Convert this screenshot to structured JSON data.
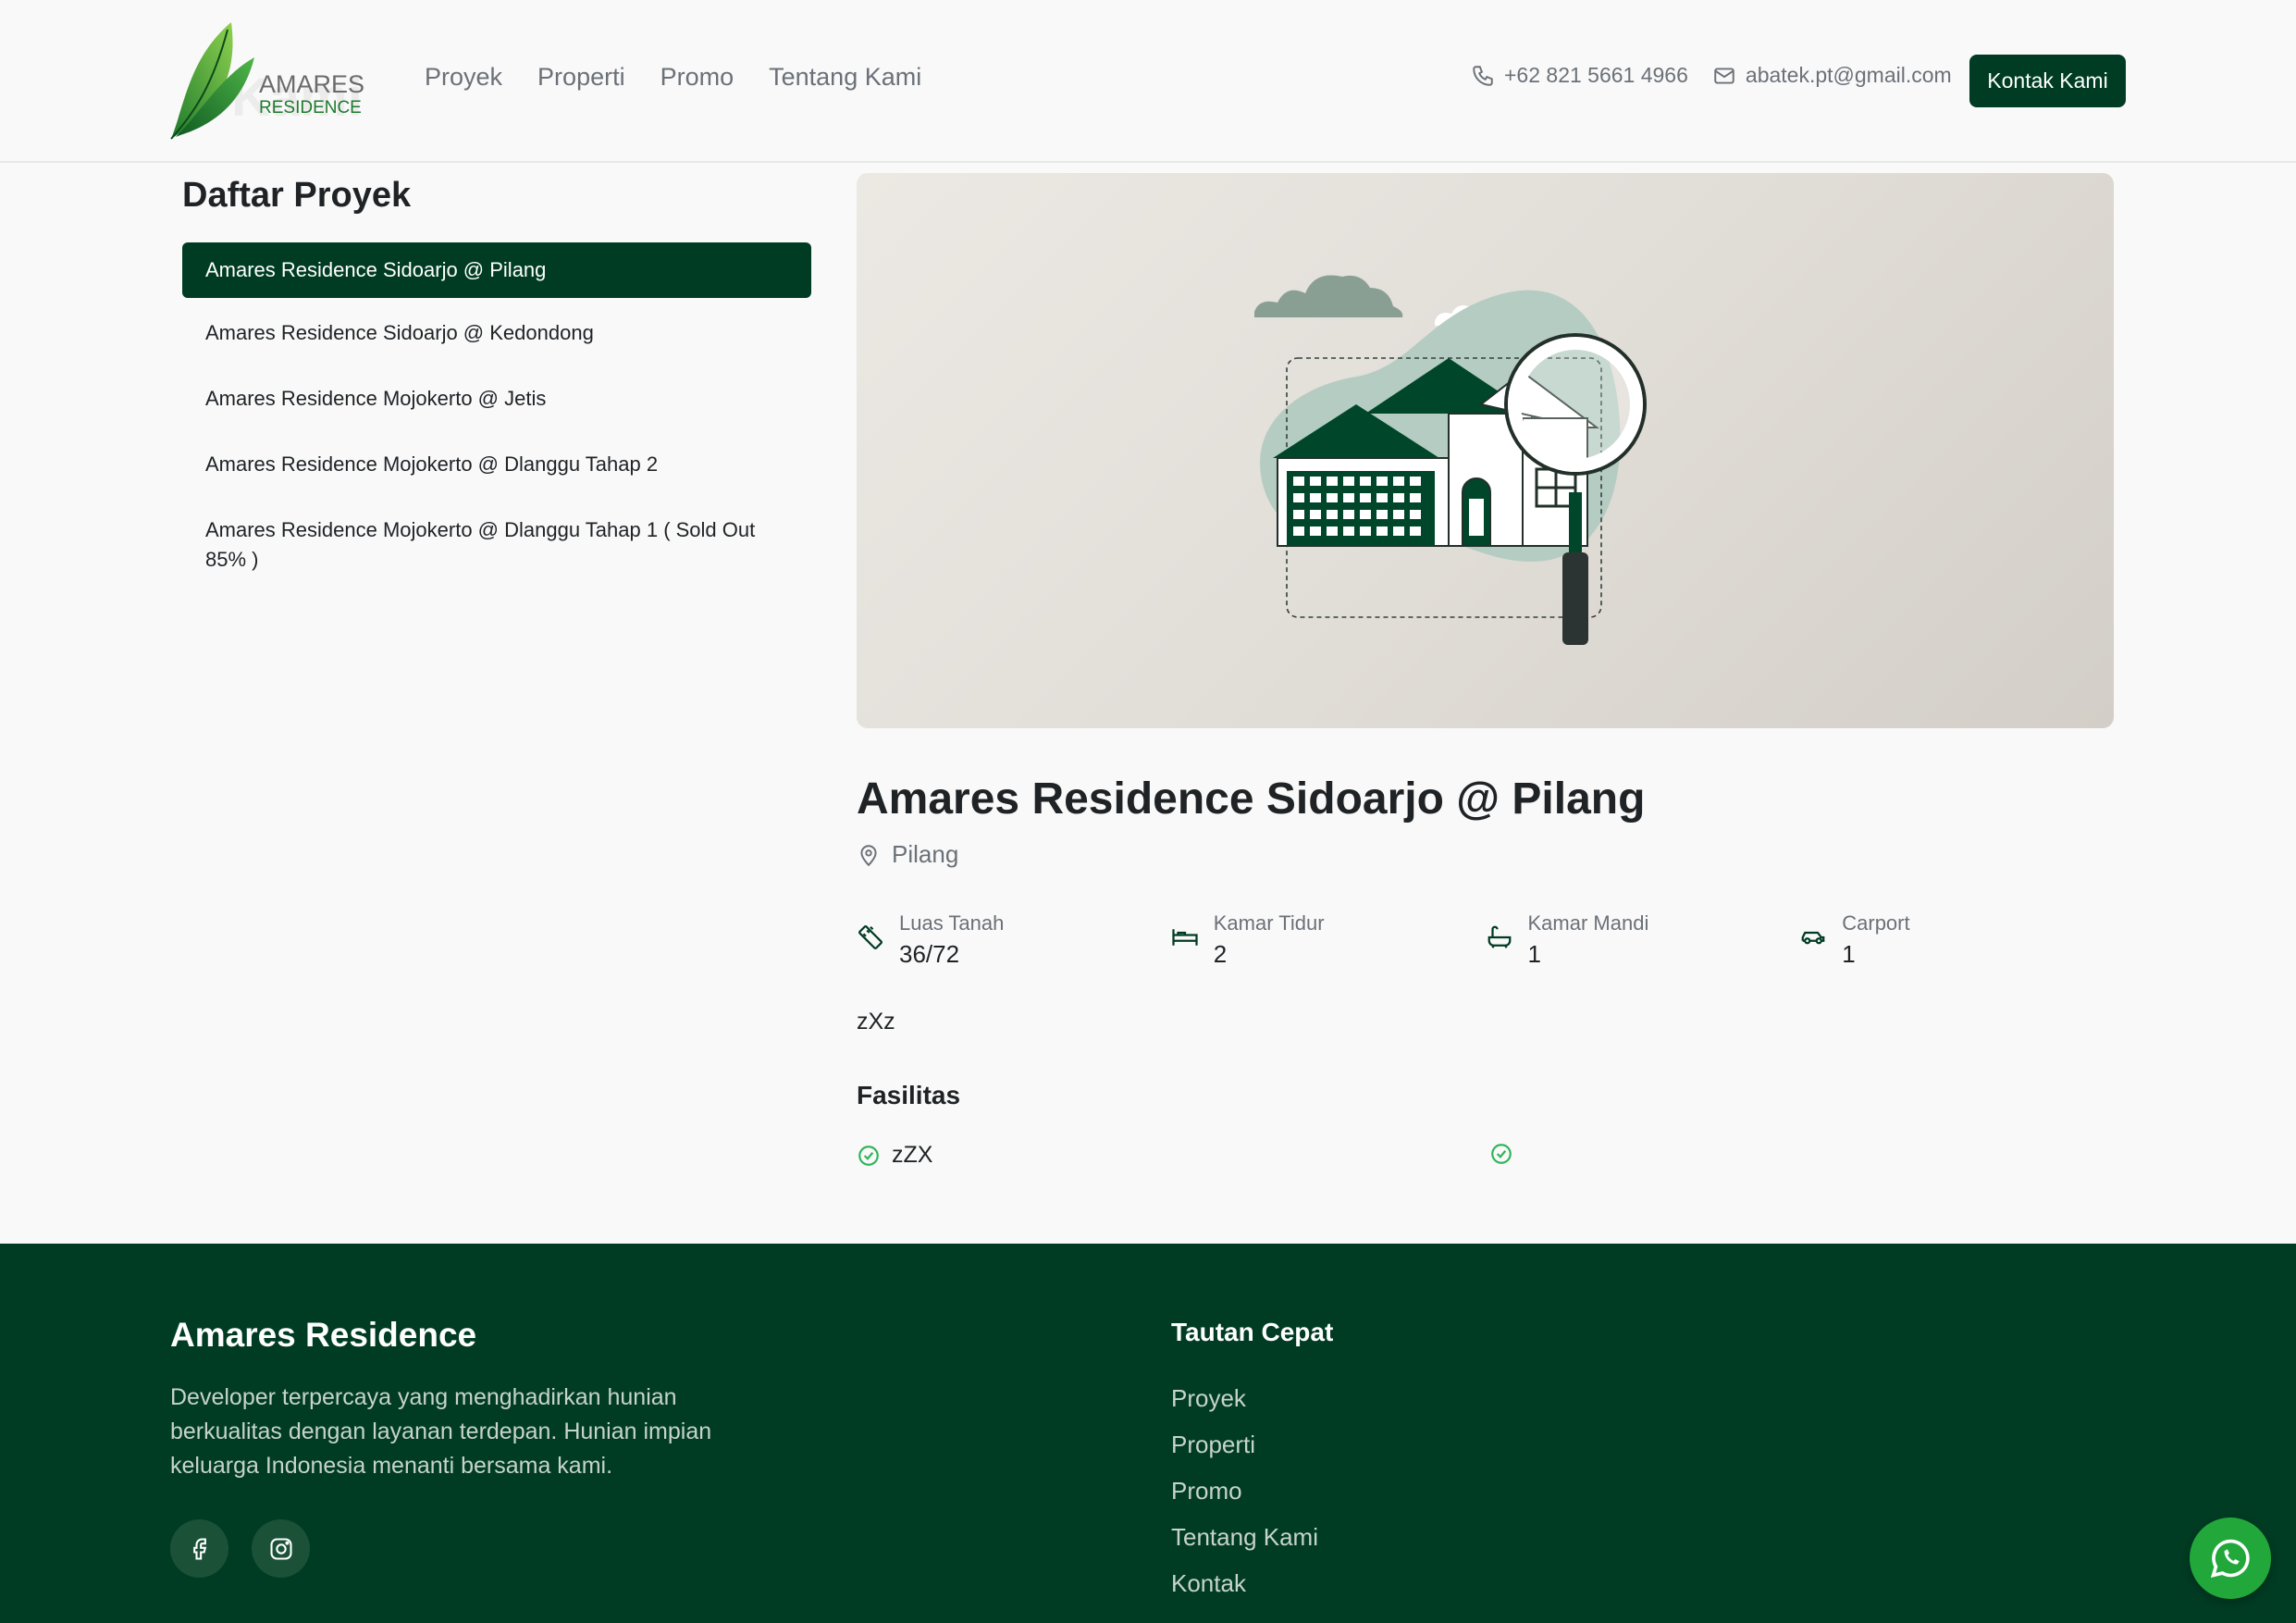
{
  "header": {
    "logo": {
      "line1": "AMARES",
      "line2": "RESIDENCE"
    },
    "ghost_text": "Kami",
    "nav": [
      "Proyek",
      "Properti",
      "Promo",
      "Tentang Kami"
    ],
    "phone": "+62 821 5661 4966",
    "email": "abatek.pt@gmail.com",
    "cta": "Kontak Kami"
  },
  "sidebar": {
    "title": "Daftar Proyek",
    "items": [
      "Amares Residence Sidoarjo @ Pilang",
      "Amares Residence Sidoarjo @ Kedondong",
      "Amares Residence Mojokerto @ Jetis",
      "Amares Residence Mojokerto @ Dlanggu Tahap 2",
      "Amares Residence Mojokerto @ Dlanggu Tahap 1 ( Sold Out 85% )"
    ],
    "active_index": 0
  },
  "property": {
    "title": "Amares Residence Sidoarjo @ Pilang",
    "location": "Pilang",
    "specs": [
      {
        "label": "Luas Tanah",
        "value": "36/72",
        "icon": "ruler-icon"
      },
      {
        "label": "Kamar Tidur",
        "value": "2",
        "icon": "bed-icon"
      },
      {
        "label": "Kamar Mandi",
        "value": "1",
        "icon": "bath-icon"
      },
      {
        "label": "Carport",
        "value": "1",
        "icon": "car-icon"
      }
    ],
    "description": "zXz",
    "facilities_title": "Fasilitas",
    "facilities": [
      "zZX",
      ""
    ]
  },
  "footer": {
    "brand": "Amares Residence",
    "description": "Developer terpercaya yang menghadirkan hunian berkualitas dengan layanan terdepan. Hunian impian keluarga Indonesia menanti bersama kami.",
    "quick_title": "Tautan Cepat",
    "quick_links": [
      "Proyek",
      "Properti",
      "Promo",
      "Tentang Kami",
      "Kontak"
    ]
  },
  "colors": {
    "primary": "#003c23",
    "accent_green": "#22a83a",
    "check_green": "#2fb45a"
  }
}
